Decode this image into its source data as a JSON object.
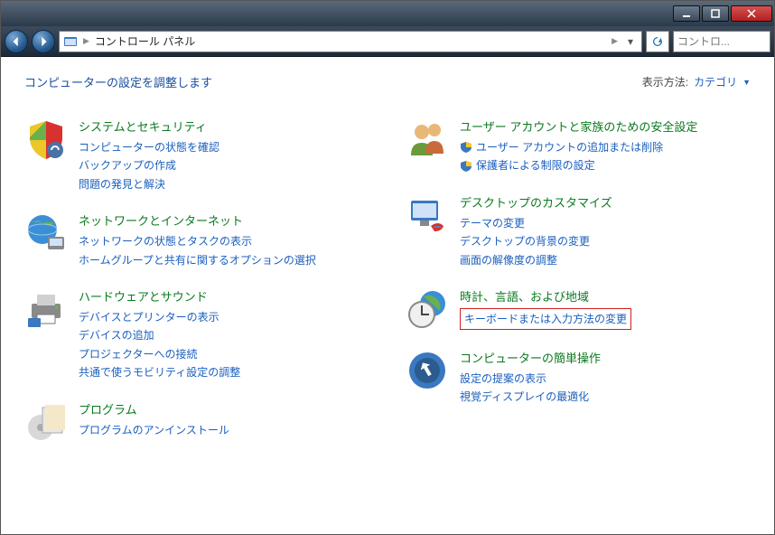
{
  "window": {
    "breadcrumb": "コントロール パネル",
    "breadcrumb_sep": "▶",
    "search_placeholder": "コントロ...",
    "header_title": "コンピューターの設定を調整します",
    "view_by_label": "表示方法:",
    "view_by_value": "カテゴリ"
  },
  "left": [
    {
      "title": "システムとセキュリティ",
      "icon": "shield-icon",
      "links": [
        {
          "text": "コンピューターの状態を確認",
          "shield": false
        },
        {
          "text": "バックアップの作成",
          "shield": false
        },
        {
          "text": "問題の発見と解決",
          "shield": false
        }
      ]
    },
    {
      "title": "ネットワークとインターネット",
      "icon": "globe-icon",
      "links": [
        {
          "text": "ネットワークの状態とタスクの表示",
          "shield": false
        },
        {
          "text": "ホームグループと共有に関するオプションの選択",
          "shield": false
        }
      ]
    },
    {
      "title": "ハードウェアとサウンド",
      "icon": "printer-icon",
      "links": [
        {
          "text": "デバイスとプリンターの表示",
          "shield": false
        },
        {
          "text": "デバイスの追加",
          "shield": false
        },
        {
          "text": "プロジェクターへの接続",
          "shield": false
        },
        {
          "text": "共通で使うモビリティ設定の調整",
          "shield": false
        }
      ]
    },
    {
      "title": "プログラム",
      "icon": "programs-icon",
      "links": [
        {
          "text": "プログラムのアンインストール",
          "shield": false
        }
      ]
    }
  ],
  "right": [
    {
      "title": "ユーザー アカウントと家族のための安全設定",
      "icon": "users-icon",
      "links": [
        {
          "text": "ユーザー アカウントの追加または削除",
          "shield": true
        },
        {
          "text": "保護者による制限の設定",
          "shield": true
        }
      ]
    },
    {
      "title": "デスクトップのカスタマイズ",
      "icon": "appearance-icon",
      "links": [
        {
          "text": "テーマの変更",
          "shield": false
        },
        {
          "text": "デスクトップの背景の変更",
          "shield": false
        },
        {
          "text": "画面の解像度の調整",
          "shield": false
        }
      ]
    },
    {
      "title": "時計、言語、および地域",
      "icon": "clock-icon",
      "links": [
        {
          "text": "キーボードまたは入力方法の変更",
          "shield": false,
          "highlighted": true
        }
      ]
    },
    {
      "title": "コンピューターの簡単操作",
      "icon": "ease-icon",
      "links": [
        {
          "text": "設定の提案の表示",
          "shield": false
        },
        {
          "text": "視覚ディスプレイの最適化",
          "shield": false
        }
      ]
    }
  ]
}
